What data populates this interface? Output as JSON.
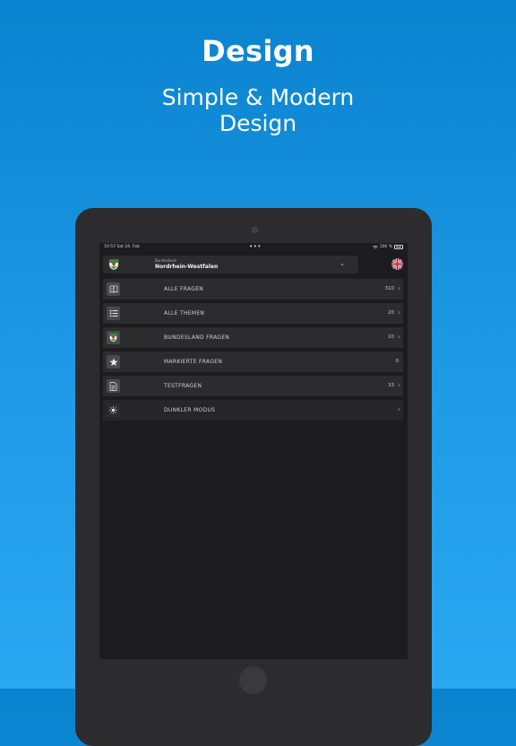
{
  "promo": {
    "headline": "Design",
    "subline_1": "Simple &  Modern",
    "subline_2": "Design"
  },
  "colors": {
    "background_top": "#0a83cf",
    "background_bottom": "#2aa7f1",
    "device_frame": "#2c2c2e",
    "screen": "#1c1c1e",
    "row": "#2c2c2e"
  },
  "statusbar": {
    "time": "10:57",
    "date": "Sat 24. Feb",
    "dots": "•••",
    "battery_text": "100 %"
  },
  "state_selector": {
    "caption": "Bundesland",
    "value": "Nordrhein-Westfalen",
    "chevron_icon": "chevron-down-icon",
    "crest_icon": "nrw-crest-icon"
  },
  "language": {
    "flag_icon": "uk-flag-icon"
  },
  "menu": {
    "items": [
      {
        "label": "ALLE FRAGEN",
        "count": "310",
        "icon": "book-icon",
        "has_arrow": true
      },
      {
        "label": "ALLE THEMEN",
        "count": "20",
        "icon": "list-icon",
        "has_arrow": true
      },
      {
        "label": "BUNDESLAND FRAGEN",
        "count": "10",
        "icon": "nrw-crest-icon",
        "has_arrow": true
      },
      {
        "label": "MARKIERTE FRAGEN",
        "count": "0",
        "icon": "star-icon",
        "has_arrow": false
      },
      {
        "label": "TESTFRAGEN",
        "count": "33",
        "icon": "document-icon",
        "has_arrow": true
      },
      {
        "label": "DUNKLER MODUS",
        "count": "",
        "icon": "sun-icon",
        "has_arrow": true
      }
    ]
  }
}
